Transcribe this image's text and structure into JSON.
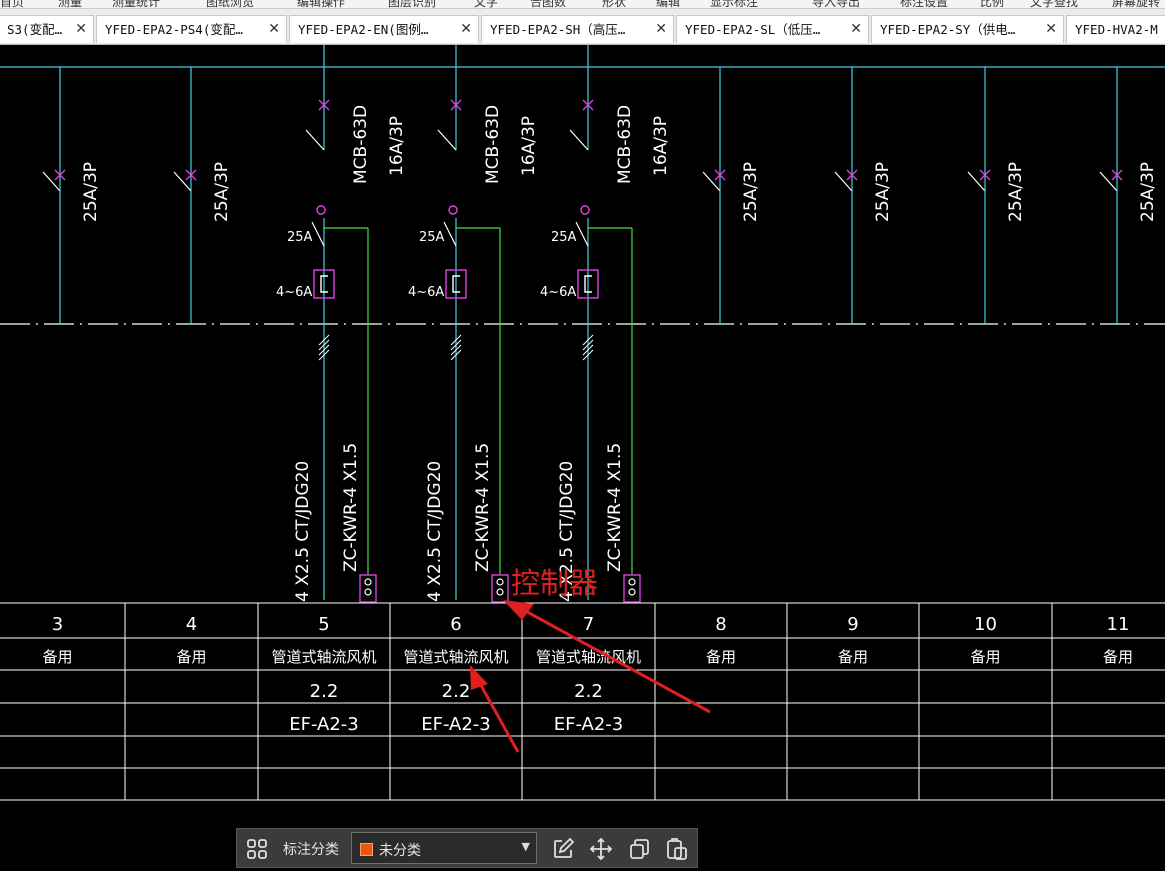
{
  "menu": {
    "items": [
      "首页",
      "测量",
      "测量统计",
      "图纸浏览",
      "编辑操作",
      "图层识别",
      "文字",
      "合图数",
      "形状",
      "编辑",
      "显示标注",
      "导入导出",
      "标注设置",
      "比例",
      "文字查找",
      "屏幕旋转"
    ]
  },
  "tabs": [
    {
      "label": "S3(变配…"
    },
    {
      "label": "YFED-EPA2-PS4(变配…"
    },
    {
      "label": "YFED-EPA2-EN(图例…"
    },
    {
      "label": "YFED-EPA2-SH（高压…"
    },
    {
      "label": "YFED-EPA2-SL（低压…"
    },
    {
      "label": "YFED-EPA2-SY（供电…"
    },
    {
      "label": "YFED-HVA2-M"
    }
  ],
  "drawing": {
    "breaker_rating": "25A/3P",
    "mcb_model": "MCB-63D",
    "mcb_rating": "16A/3P",
    "contactor": "25A",
    "thermal_relay": "4~6A",
    "power_cable": "4 X2.5  CT/JDG20",
    "control_cable": "ZC-KWR-4 X1.5",
    "annotation": "控制器",
    "columns": [
      {
        "no": "3",
        "name": "备用",
        "power": "",
        "code": ""
      },
      {
        "no": "4",
        "name": "备用",
        "power": "",
        "code": ""
      },
      {
        "no": "5",
        "name": "管道式轴流风机",
        "power": "2.2",
        "code": "EF-A2-3"
      },
      {
        "no": "6",
        "name": "管道式轴流风机",
        "power": "2.2",
        "code": "EF-A2-3"
      },
      {
        "no": "7",
        "name": "管道式轴流风机",
        "power": "2.2",
        "code": "EF-A2-3"
      },
      {
        "no": "8",
        "name": "备用",
        "power": "",
        "code": ""
      },
      {
        "no": "9",
        "name": "备用",
        "power": "",
        "code": ""
      },
      {
        "no": "10",
        "name": "备用",
        "power": "",
        "code": ""
      },
      {
        "no": "11",
        "name": "备用",
        "power": "",
        "code": ""
      }
    ]
  },
  "toolbar": {
    "label": "标注分类",
    "select_value": "未分类",
    "icons": [
      "grid-icon",
      "edit-icon",
      "move-icon",
      "copy-icon",
      "paste-icon"
    ]
  },
  "colors": {
    "background": "#000000",
    "busbar": "#40d0e0",
    "control_wire": "#40e040",
    "symbol_magenta": "#e040e0",
    "annotation_red": "#e02020"
  }
}
